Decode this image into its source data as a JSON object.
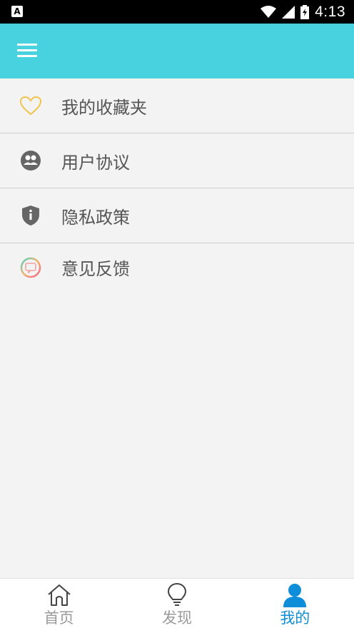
{
  "status_bar": {
    "time": "4:13",
    "notification_icon_letter": "A"
  },
  "toolbar": {
    "menu_icon": "hamburger-menu-icon"
  },
  "menu_items": [
    {
      "label": "我的收藏夹",
      "icon": "heart-icon"
    },
    {
      "label": "用户协议",
      "icon": "users-icon"
    },
    {
      "label": "隐私政策",
      "icon": "shield-info-icon"
    },
    {
      "label": "意见反馈",
      "icon": "feedback-chat-icon"
    }
  ],
  "tabs": [
    {
      "label": "首页",
      "icon": "home-icon",
      "active": false
    },
    {
      "label": "发现",
      "icon": "lightbulb-icon",
      "active": false
    },
    {
      "label": "我的",
      "icon": "person-icon",
      "active": true
    }
  ],
  "colors": {
    "header": "#48d1de",
    "active_tab": "#0e8ed8",
    "background": "#f3f3f3"
  }
}
